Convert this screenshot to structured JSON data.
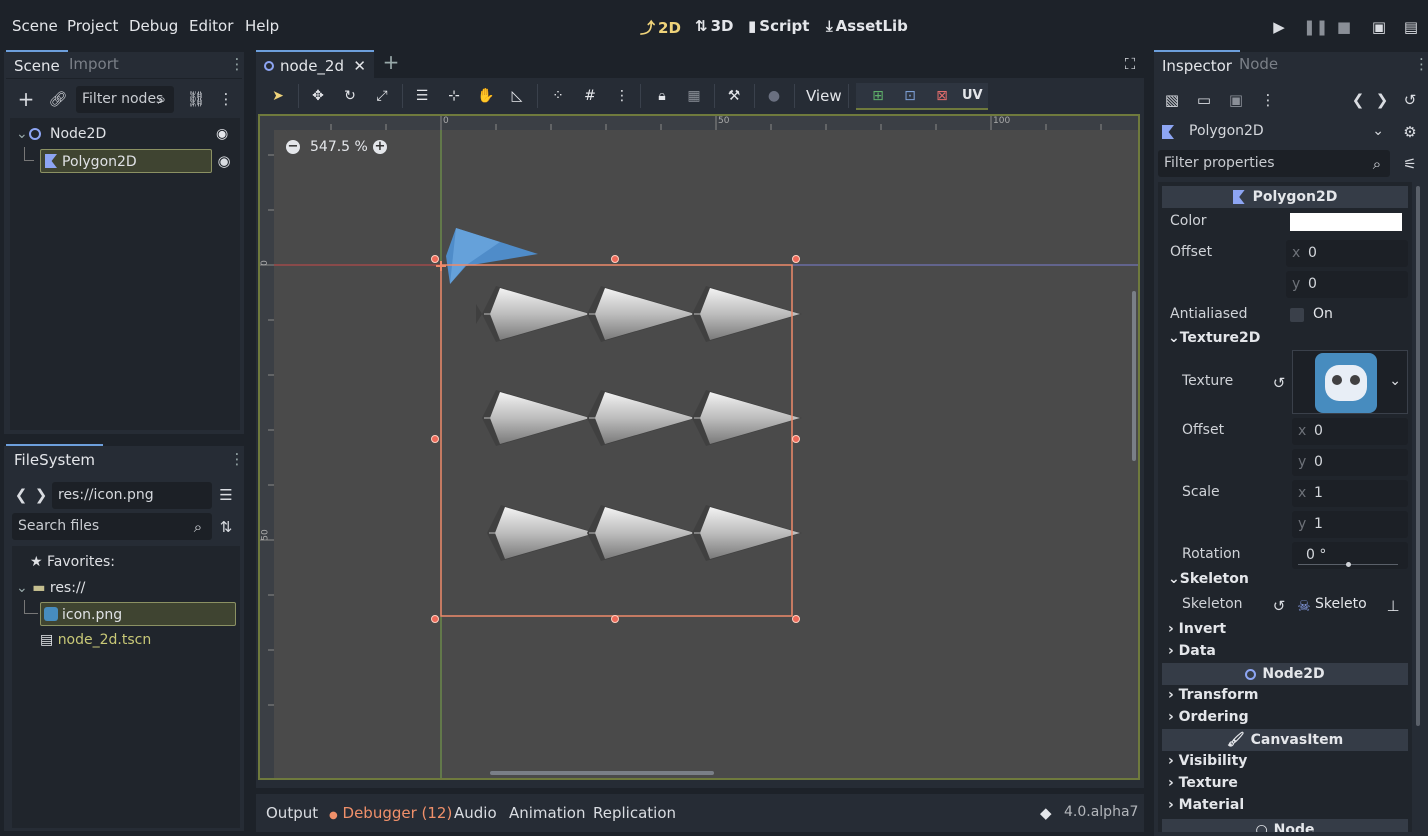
{
  "menu": {
    "scene": "Scene",
    "project": "Project",
    "debug": "Debug",
    "editor": "Editor",
    "help": "Help"
  },
  "workspaces": {
    "w2d": "2D",
    "w3d": "3D",
    "script": "Script",
    "assetlib": "AssetLib"
  },
  "scene_dock": {
    "tab_scene": "Scene",
    "tab_import": "Import",
    "filter_placeholder": "Filter nodes",
    "tree": [
      {
        "label": "Node2D"
      },
      {
        "label": "Polygon2D"
      }
    ]
  },
  "filesystem": {
    "tab": "FileSystem",
    "path": "res://icon.png",
    "search_placeholder": "Search files",
    "items": [
      {
        "label": "Favorites:"
      },
      {
        "label": "res://"
      },
      {
        "label": "icon.png"
      },
      {
        "label": "node_2d.tscn"
      }
    ]
  },
  "editor": {
    "tab_label": "node_2d",
    "zoom": "547.5 %",
    "view_menu": "View",
    "uv_label": "UV",
    "ruler": {
      "h": [
        "0",
        "50",
        "100"
      ],
      "v": [
        "0",
        "50"
      ]
    }
  },
  "bottom": {
    "output": "Output",
    "debugger": "Debugger (12)",
    "audio": "Audio",
    "animation": "Animation",
    "replication": "Replication",
    "version": "4.0.alpha7"
  },
  "inspector": {
    "tab_inspector": "Inspector",
    "tab_node": "Node",
    "object": "Polygon2D",
    "filter_placeholder": "Filter properties",
    "section_polygon": "Polygon2D",
    "color_label": "Color",
    "color_value": "#ffffff",
    "offset_label": "Offset",
    "offset_x": "0",
    "offset_y": "0",
    "antialiased_label": "Antialiased",
    "antialiased_value": "On",
    "group_texture": "Texture2D",
    "texture_label": "Texture",
    "tex_offset_label": "Offset",
    "tex_offset_x": "0",
    "tex_offset_y": "0",
    "scale_label": "Scale",
    "scale_x": "1",
    "scale_y": "1",
    "rotation_label": "Rotation",
    "rotation_value": "0 °",
    "group_skeleton": "Skeleton",
    "skeleton_label": "Skeleton",
    "skeleton_value": "Skeleto",
    "group_invert": "Invert",
    "group_data": "Data",
    "section_node2d": "Node2D",
    "group_transform": "Transform",
    "group_ordering": "Ordering",
    "section_canvas": "CanvasItem",
    "group_visibility": "Visibility",
    "group_texture2": "Texture",
    "group_material": "Material",
    "section_node": "Node",
    "axis_x": "x",
    "axis_y": "y"
  },
  "colors": {
    "accent": "#6d9fdc",
    "selection": "#ee8a6a",
    "workspace_active": "#efd37a",
    "debugger": "#f0906a",
    "node_header": "#e8a"
  }
}
